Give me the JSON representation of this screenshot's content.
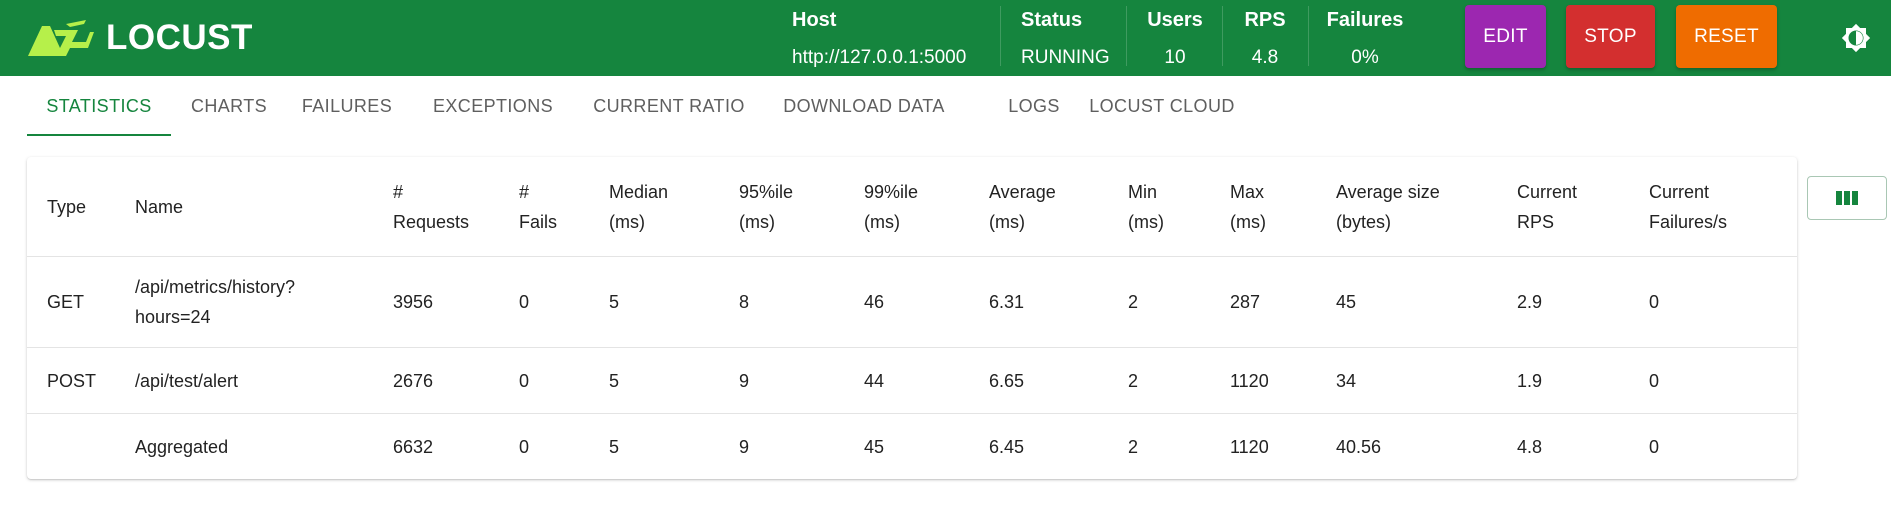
{
  "app": {
    "name": "LOCUST"
  },
  "header": {
    "host": {
      "label": "Host",
      "value": "http://127.0.0.1:5000"
    },
    "status": {
      "label": "Status",
      "value": "RUNNING"
    },
    "users": {
      "label": "Users",
      "value": "10"
    },
    "rps": {
      "label": "RPS",
      "value": "4.8"
    },
    "failures": {
      "label": "Failures",
      "value": "0%"
    },
    "buttons": {
      "edit": "EDIT",
      "stop": "STOP",
      "reset": "RESET"
    },
    "theme_icon": "brightness-icon"
  },
  "tabs": [
    {
      "label": "STATISTICS",
      "active": true
    },
    {
      "label": "CHARTS"
    },
    {
      "label": "FAILURES"
    },
    {
      "label": "EXCEPTIONS"
    },
    {
      "label": "CURRENT RATIO"
    },
    {
      "label": "DOWNLOAD DATA"
    },
    {
      "label": "LOGS"
    },
    {
      "label": "LOCUST CLOUD"
    }
  ],
  "table": {
    "columns": [
      [
        "Type"
      ],
      [
        "Name"
      ],
      [
        "#",
        "Requests"
      ],
      [
        "#",
        "Fails"
      ],
      [
        "Median",
        "(ms)"
      ],
      [
        "95%ile",
        "(ms)"
      ],
      [
        "99%ile",
        "(ms)"
      ],
      [
        "Average",
        "(ms)"
      ],
      [
        "Min",
        "(ms)"
      ],
      [
        "Max",
        "(ms)"
      ],
      [
        "Average size",
        "(bytes)"
      ],
      [
        "Current",
        "RPS"
      ],
      [
        "Current",
        "Failures/s"
      ]
    ],
    "rows": [
      {
        "type": "GET",
        "name": [
          "/api/metrics/history?",
          "hours=24"
        ],
        "requests": "3956",
        "fails": "0",
        "median": "5",
        "p95": "8",
        "p99": "46",
        "average": "6.31",
        "min": "2",
        "max": "287",
        "avg_size": "45",
        "current_rps": "2.9",
        "current_failures": "0"
      },
      {
        "type": "POST",
        "name": [
          "/api/test/alert"
        ],
        "requests": "2676",
        "fails": "0",
        "median": "5",
        "p95": "9",
        "p99": "44",
        "average": "6.65",
        "min": "2",
        "max": "1120",
        "avg_size": "34",
        "current_rps": "1.9",
        "current_failures": "0"
      },
      {
        "type": "",
        "name": [
          "Aggregated"
        ],
        "requests": "6632",
        "fails": "0",
        "median": "5",
        "p95": "9",
        "p99": "45",
        "average": "6.45",
        "min": "2",
        "max": "1120",
        "avg_size": "40.56",
        "current_rps": "4.8",
        "current_failures": "0"
      }
    ],
    "column_toggle_icon": "view-column-icon"
  },
  "colors": {
    "brand": "#15853e",
    "edit": "#9c27b0",
    "stop": "#d32f2f",
    "reset": "#ef6c00",
    "logo_accent": "#b6f04a"
  }
}
